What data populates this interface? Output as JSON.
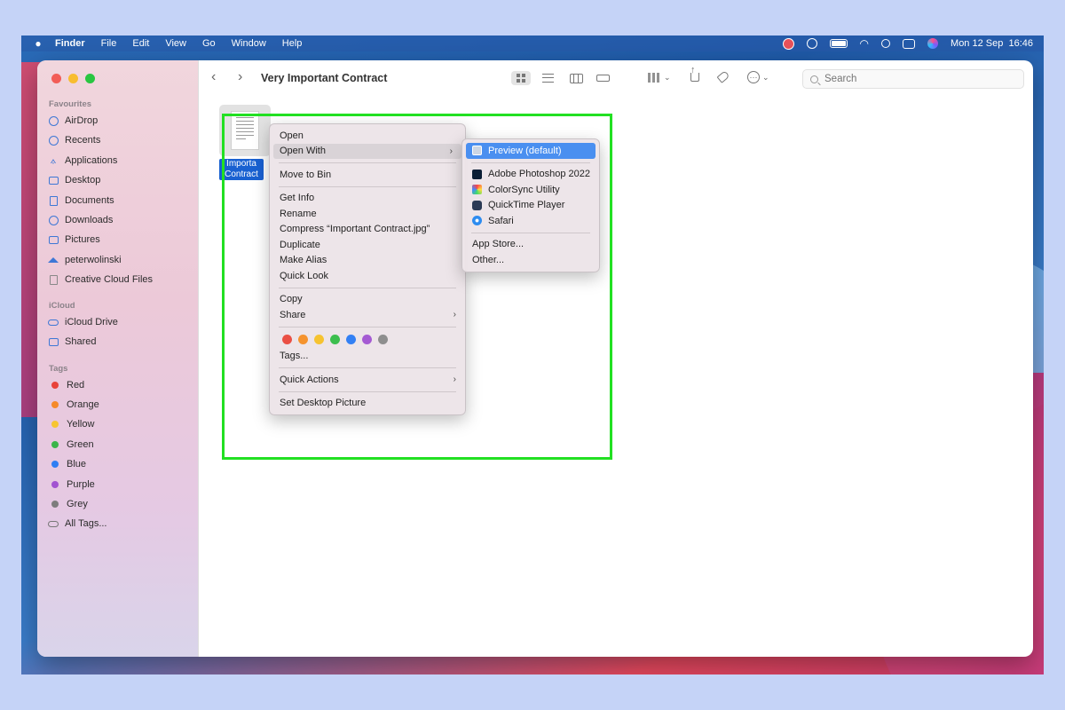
{
  "menubar": {
    "app": "Finder",
    "items": [
      "File",
      "Edit",
      "View",
      "Go",
      "Window",
      "Help"
    ],
    "clock": "Mon 12 Sep  16:46"
  },
  "toolbar": {
    "back_icon": "chevron-left-icon",
    "forward_icon": "chevron-right-icon",
    "title": "Very Important Contract",
    "search_placeholder": "Search"
  },
  "sidebar": {
    "favourites_heading": "Favourites",
    "favourites": [
      {
        "label": "AirDrop",
        "icon": "airdrop-icon"
      },
      {
        "label": "Recents",
        "icon": "clock-icon"
      },
      {
        "label": "Applications",
        "icon": "applications-icon"
      },
      {
        "label": "Desktop",
        "icon": "desktop-icon"
      },
      {
        "label": "Documents",
        "icon": "document-icon"
      },
      {
        "label": "Downloads",
        "icon": "download-icon"
      },
      {
        "label": "Pictures",
        "icon": "pictures-icon"
      },
      {
        "label": "peterwolinski",
        "icon": "home-icon"
      },
      {
        "label": "Creative Cloud Files",
        "icon": "file-icon"
      }
    ],
    "icloud_heading": "iCloud",
    "icloud": [
      {
        "label": "iCloud Drive",
        "icon": "cloud-icon"
      },
      {
        "label": "Shared",
        "icon": "shared-folder-icon"
      }
    ],
    "tags_heading": "Tags",
    "tags": [
      {
        "label": "Red",
        "color": "#e8423a"
      },
      {
        "label": "Orange",
        "color": "#f58a2a"
      },
      {
        "label": "Yellow",
        "color": "#f7c531"
      },
      {
        "label": "Green",
        "color": "#3bb54a"
      },
      {
        "label": "Blue",
        "color": "#2f7ef3"
      },
      {
        "label": "Purple",
        "color": "#a253d1"
      },
      {
        "label": "Grey",
        "color": "#7d7d7d"
      },
      {
        "label": "All Tags...",
        "icon": "tag-pill-icon"
      }
    ]
  },
  "file": {
    "label_line1": "Importa",
    "label_line2": "Contract"
  },
  "context_menu": {
    "open": "Open",
    "open_with": "Open With",
    "move_to_bin": "Move to Bin",
    "get_info": "Get Info",
    "rename": "Rename",
    "compress": "Compress “Important Contract.jpg”",
    "duplicate": "Duplicate",
    "make_alias": "Make Alias",
    "quick_look": "Quick Look",
    "copy": "Copy",
    "share": "Share",
    "tag_colors": [
      "#ea4f44",
      "#f5932e",
      "#f6c330",
      "#3cbe4e",
      "#3380f4",
      "#a55ad3",
      "#8e8e8e"
    ],
    "tags": "Tags...",
    "quick_actions": "Quick Actions",
    "set_desktop_picture": "Set Desktop Picture"
  },
  "open_with_menu": {
    "default_app": "Preview (default)",
    "apps": [
      "Adobe Photoshop 2022",
      "ColorSync Utility",
      "QuickTime Player",
      "Safari"
    ],
    "app_store": "App Store...",
    "other": "Other..."
  },
  "colors": {
    "highlight": "#22e022",
    "selection": "#4a8ff0",
    "file_label": "#1961d1"
  }
}
